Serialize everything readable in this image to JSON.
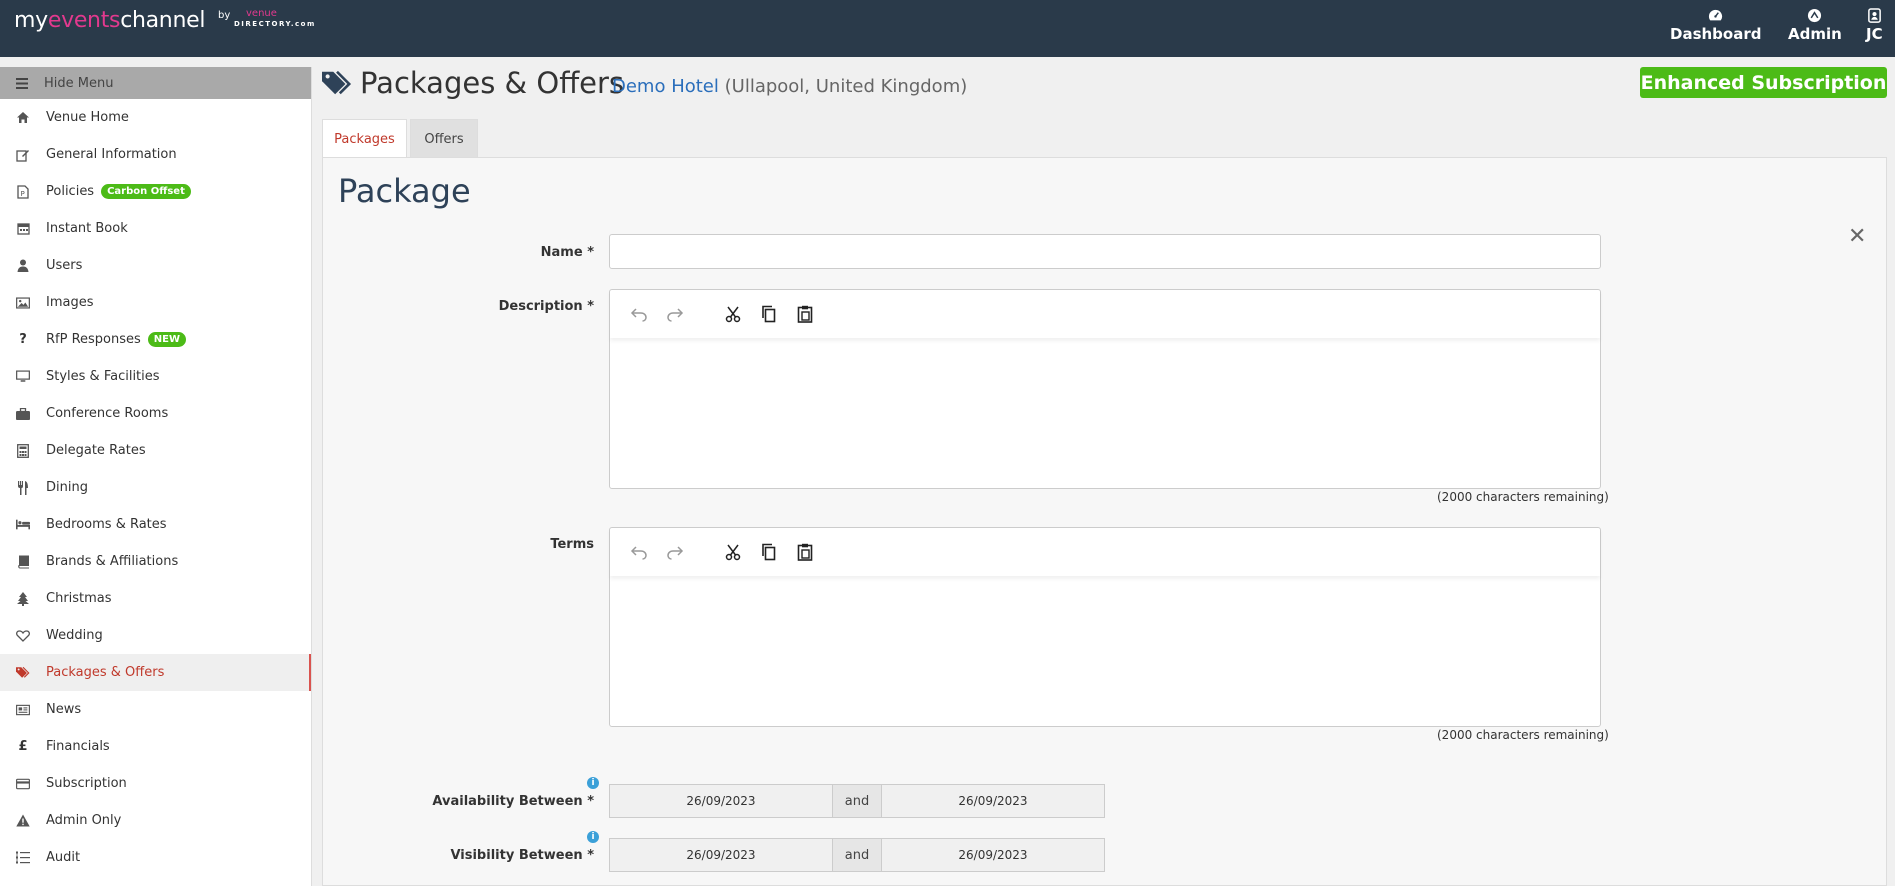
{
  "brand": {
    "part1": "my",
    "part2": "events",
    "part3": "channel",
    "by": "by",
    "venue": "venue",
    "directory": "DIRECTORY.com",
    "colors": {
      "topbar": "#2a3a4a",
      "pink": "#e2398e",
      "green": "#4cbb17",
      "active": "#c0392b"
    }
  },
  "topnav": {
    "dashboard": "Dashboard",
    "admin": "Admin",
    "user": "JC"
  },
  "sidebar": {
    "hide_menu": "Hide Menu",
    "items": [
      {
        "label": "Venue Home",
        "icon": "home-icon"
      },
      {
        "label": "General Information",
        "icon": "edit-icon"
      },
      {
        "label": "Policies",
        "icon": "document-icon",
        "badge": "Carbon Offset"
      },
      {
        "label": "Instant Book",
        "icon": "calendar-icon"
      },
      {
        "label": "Users",
        "icon": "user-icon"
      },
      {
        "label": "Images",
        "icon": "image-icon"
      },
      {
        "label": "RfP Responses",
        "icon": "question-icon",
        "badge": "NEW"
      },
      {
        "label": "Styles & Facilities",
        "icon": "monitor-icon"
      },
      {
        "label": "Conference Rooms",
        "icon": "briefcase-icon"
      },
      {
        "label": "Delegate Rates",
        "icon": "calculator-icon"
      },
      {
        "label": "Dining",
        "icon": "utensils-icon"
      },
      {
        "label": "Bedrooms & Rates",
        "icon": "bed-icon"
      },
      {
        "label": "Brands & Affiliations",
        "icon": "book-icon"
      },
      {
        "label": "Christmas",
        "icon": "tree-icon"
      },
      {
        "label": "Wedding",
        "icon": "heart-icon"
      },
      {
        "label": "Packages & Offers",
        "icon": "tags-icon",
        "active": true
      },
      {
        "label": "News",
        "icon": "newspaper-icon"
      },
      {
        "label": "Financials",
        "icon": "pound-icon"
      },
      {
        "label": "Subscription",
        "icon": "credit-card-icon"
      },
      {
        "label": "Admin Only",
        "icon": "warning-icon"
      },
      {
        "label": "Audit",
        "icon": "list-icon"
      }
    ]
  },
  "header": {
    "title": "Packages & Offers",
    "venue_name": "Demo Hotel",
    "venue_location": "(Ullapool, United Kingdom)",
    "subscription": "Enhanced Subscription"
  },
  "tabs": {
    "packages": "Packages",
    "offers": "Offers"
  },
  "form": {
    "title": "Package",
    "name_label": "Name *",
    "name_value": "",
    "description_label": "Description *",
    "description_remaining": "(2000 characters remaining)",
    "terms_label": "Terms",
    "terms_remaining": "(2000 characters remaining)",
    "availability_label": "Availability Between *",
    "availability_from": "26/09/2023",
    "availability_to": "26/09/2023",
    "visibility_label": "Visibility Between *",
    "visibility_from": "26/09/2023",
    "visibility_to": "26/09/2023",
    "and": "and",
    "info": "i"
  }
}
